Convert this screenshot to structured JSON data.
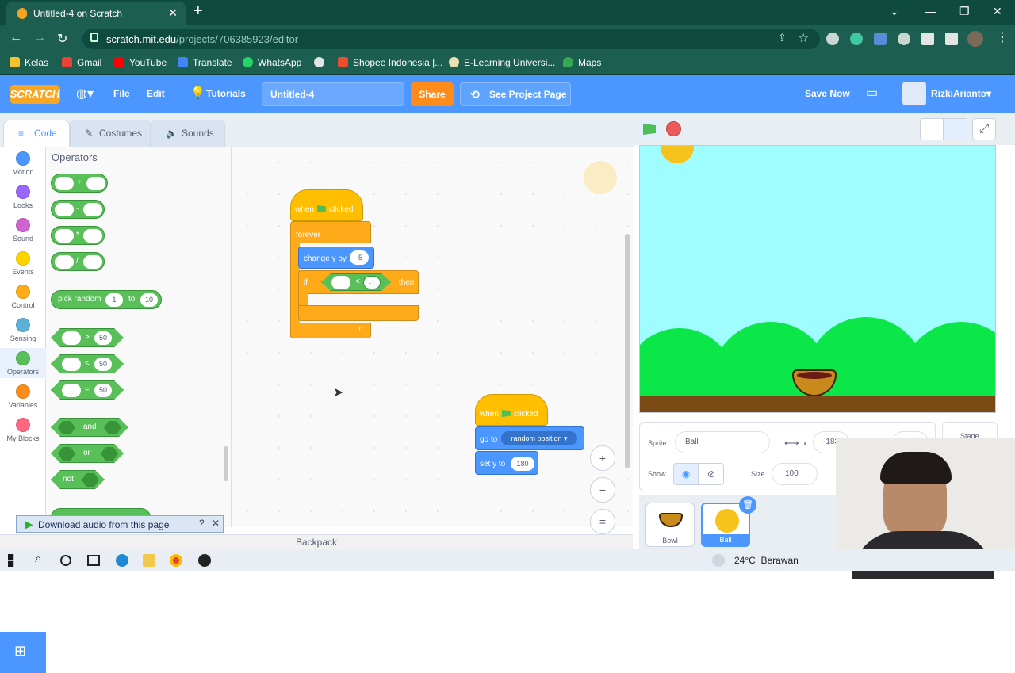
{
  "browser": {
    "tab_title": "Untitled-4 on Scratch",
    "tab_close": "✕",
    "new_tab": "+",
    "url_host": "scratch.mit.edu",
    "url_path": "/projects/706385923/editor",
    "bookmarks": [
      "Kelas",
      "Gmail",
      "YouTube",
      "Translate",
      "WhatsApp",
      "Shopee Indonesia |...",
      "E-Learning Universi...",
      "Maps"
    ]
  },
  "scratch": {
    "logo": "SCRATCH",
    "menu": {
      "file": "File",
      "edit": "Edit",
      "tutorials": "Tutorials"
    },
    "project_title": "Untitled-4",
    "share": "Share",
    "see_project_page": "See Project Page",
    "save_now": "Save Now",
    "username": "RizkiArianto",
    "tabs": {
      "code": "Code",
      "costumes": "Costumes",
      "sounds": "Sounds"
    },
    "categories": [
      {
        "label": "Motion",
        "color": "#4c97ff"
      },
      {
        "label": "Looks",
        "color": "#9966ff"
      },
      {
        "label": "Sound",
        "color": "#cf63cf"
      },
      {
        "label": "Events",
        "color": "#ffd500"
      },
      {
        "label": "Control",
        "color": "#ffab19"
      },
      {
        "label": "Sensing",
        "color": "#5cb1d6"
      },
      {
        "label": "Operators",
        "color": "#59c059"
      },
      {
        "label": "Variables",
        "color": "#ff8c1a"
      },
      {
        "label": "My Blocks",
        "color": "#ff6680"
      }
    ],
    "palette": {
      "title": "Operators",
      "arith": [
        "+",
        "-",
        "*",
        "/"
      ],
      "pick_random": {
        "label": "pick random",
        "to": "to",
        "from": "1",
        "to_val": "10"
      },
      "compare": [
        {
          "op": ">",
          "val": "50"
        },
        {
          "op": "<",
          "val": "50"
        },
        {
          "op": "=",
          "val": "50"
        }
      ],
      "logic": [
        "and",
        "or",
        "not"
      ]
    },
    "script1": {
      "hat": "when",
      "clicked": "clicked",
      "forever": "forever",
      "change_y": "change y by",
      "change_val": "-5",
      "if": "if",
      "lt": "<",
      "cond_val": "-1",
      "then": "then"
    },
    "script2": {
      "hat": "when",
      "clicked": "clicked",
      "go_to": "go to",
      "go_target": "random position",
      "set_y": "set y to",
      "set_val": "180"
    },
    "zoom": {
      "in": "+",
      "out": "−",
      "reset": "="
    },
    "backpack": "Backpack",
    "download_bar": "Download audio from this page",
    "sprite_info": {
      "sprite_label": "Sprite",
      "sprite_name": "Ball",
      "x_label": "x",
      "x_val": "-183",
      "show_label": "Show",
      "size_label": "Size",
      "size_val": "100",
      "stage_label": "Stage"
    },
    "sprites": [
      "Bowl",
      "Ball"
    ]
  },
  "taskbar": {
    "weather": "24°C  Berawan"
  }
}
